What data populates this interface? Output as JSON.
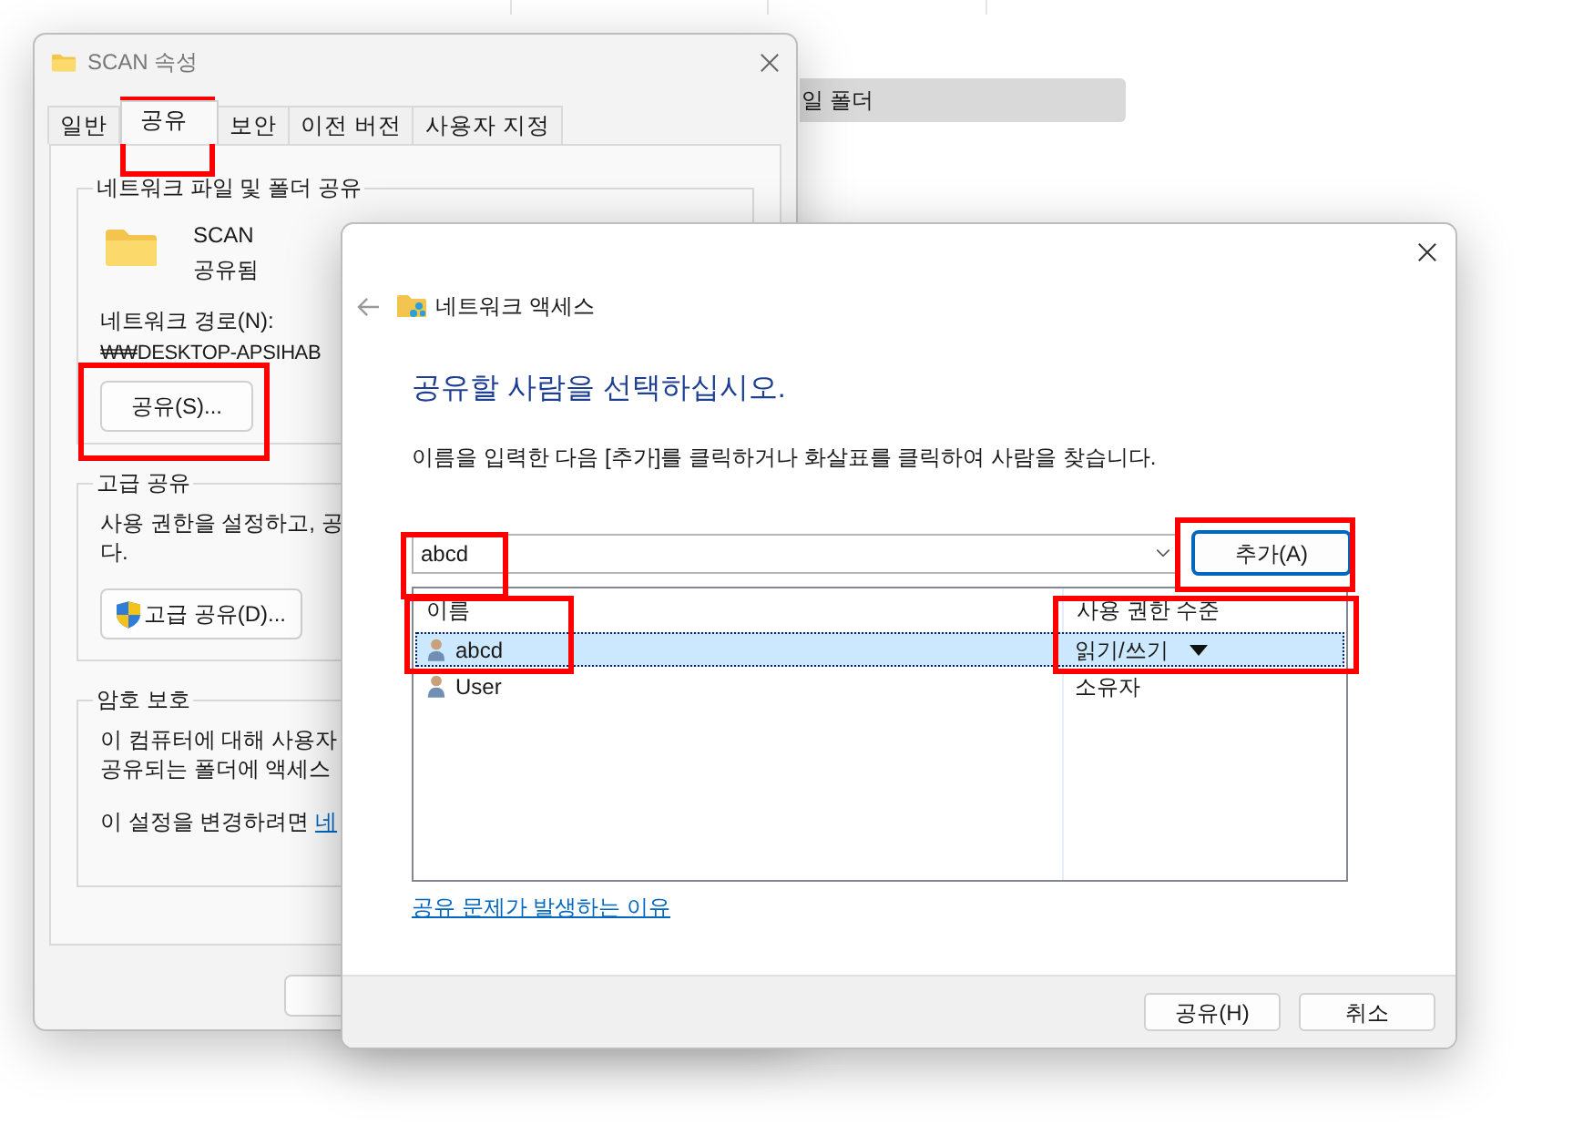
{
  "background_window": {
    "selected_row": "일 폴더"
  },
  "properties_window": {
    "title": "SCAN 속성",
    "tabs": [
      {
        "label": "일반",
        "selected": false,
        "highlighted": false
      },
      {
        "label": "공유",
        "selected": true,
        "highlighted": true
      },
      {
        "label": "보안",
        "selected": false,
        "highlighted": false
      },
      {
        "label": "이전 버전",
        "selected": false,
        "highlighted": false
      },
      {
        "label": "사용자 지정",
        "selected": false,
        "highlighted": false
      }
    ],
    "network_share": {
      "group_title": "네트워크 파일 및 폴더 공유",
      "folder_name": "SCAN",
      "folder_status": "공유됨",
      "path_label": "네트워크 경로(N):",
      "path": "₩₩DESKTOP-APSIHAB",
      "share_button": {
        "label": "공유(S)...",
        "highlighted": true
      }
    },
    "advanced_share": {
      "group_title": "고급 공유",
      "lines": [
        "사용 권한을 설정하고, 공",
        "다."
      ],
      "button": "고급 공유(D)..."
    },
    "password": {
      "group_title": "암호 보호",
      "lines": [
        "이 컴퓨터에 대해 사용자",
        "공유되는 폴더에 액세스"
      ],
      "change_text": "이 설정을 변경하려면",
      "link": "네"
    }
  },
  "network_access_dialog": {
    "title": "네트워크 액세스",
    "heading": "공유할 사람을 선택하십시오.",
    "instruction": "이름을 입력한 다음 [추가]를 클릭하거나 화살표를 클릭하여 사람을 찾습니다.",
    "name_input": {
      "value": "abcd",
      "highlighted": true
    },
    "add_button": {
      "label": "추가(A)",
      "highlighted": true
    },
    "columns": [
      {
        "label": "이름",
        "highlighted": true
      },
      {
        "label": "사용 권한 수준",
        "highlighted": true
      }
    ],
    "rows": [
      {
        "name": "abcd",
        "permission": "읽기/쓰기",
        "selected": true
      },
      {
        "name": "User",
        "permission": "소유자",
        "selected": false
      }
    ],
    "help_link": "공유 문제가 발생하는 이유",
    "buttons": [
      "공유(H)",
      "취소"
    ]
  }
}
